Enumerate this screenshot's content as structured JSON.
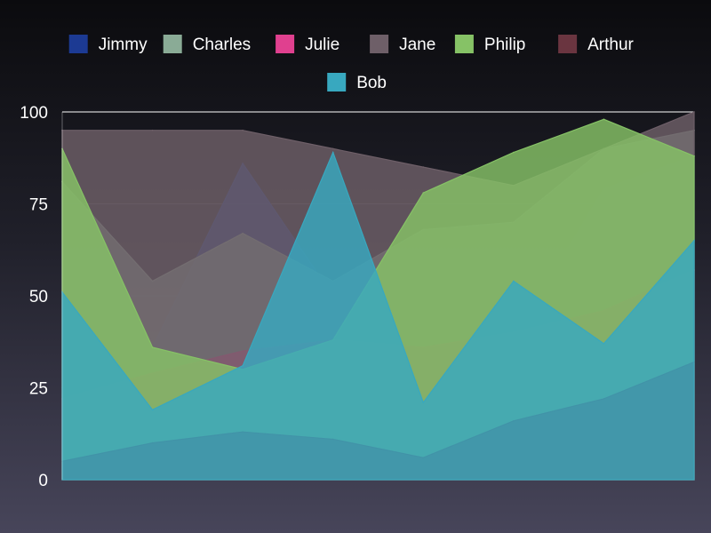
{
  "chart_data": {
    "type": "area",
    "title": "",
    "xlabel": "",
    "ylabel": "",
    "ylim": [
      0,
      100
    ],
    "yticks": [
      0,
      25,
      50,
      75,
      100
    ],
    "grid": true,
    "legend_position": "top",
    "x": [
      1,
      2,
      3,
      4,
      5,
      6,
      7,
      8
    ],
    "series": [
      {
        "name": "Jimmy",
        "color": "#1c3a93",
        "values": [
          25,
          36,
          86,
          50,
          30,
          38,
          79,
          88
        ]
      },
      {
        "name": "Charles",
        "color": "#8aab96",
        "values": [
          81,
          54,
          67,
          54,
          68,
          70,
          90,
          95
        ]
      },
      {
        "name": "Julie",
        "color": "#e0408f",
        "values": [
          22,
          29,
          35,
          38,
          36,
          40,
          46,
          57
        ]
      },
      {
        "name": "Jane",
        "color": "#6e5f68",
        "values": [
          95,
          95,
          95,
          90,
          85,
          80,
          90,
          100
        ]
      },
      {
        "name": "Philip",
        "color": "#86c266",
        "values": [
          90,
          36,
          30,
          38,
          78,
          89,
          98,
          88
        ]
      },
      {
        "name": "Arthur",
        "color": "#6a3540",
        "values": [
          5,
          10,
          13,
          11,
          6,
          16,
          22,
          32
        ]
      },
      {
        "name": "Bob",
        "color": "#38a8bf",
        "values": [
          51,
          19,
          31,
          89,
          21,
          54,
          37,
          65
        ]
      }
    ]
  }
}
